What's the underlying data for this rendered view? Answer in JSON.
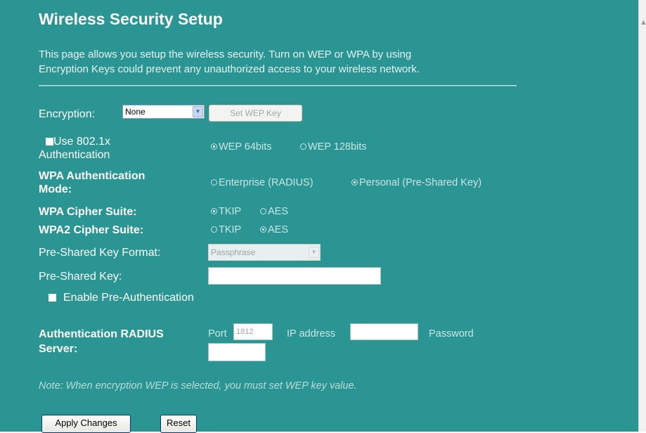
{
  "page": {
    "title": "Wireless Security Setup",
    "description_line1": "This page allows you setup the wireless security. Turn on WEP or WPA by using",
    "description_line2": "Encryption Keys could prevent any unauthorized access to your wireless network."
  },
  "encryption": {
    "label": "Encryption:",
    "selected": "None",
    "set_wep_key_button": "Set WEP Key"
  },
  "use_8021x": {
    "label_line1": "Use 802.1x",
    "label_line2": "Authentication",
    "checked": true,
    "options": [
      {
        "label": "WEP 64bits",
        "selected": true
      },
      {
        "label": "WEP 128bits",
        "selected": false
      }
    ]
  },
  "wpa_auth_mode": {
    "label_line1": "WPA Authentication",
    "label_line2": "Mode:",
    "options": [
      {
        "label": "Enterprise (RADIUS)",
        "selected": false
      },
      {
        "label": "Personal (Pre-Shared Key)",
        "selected": true
      }
    ]
  },
  "wpa_cipher": {
    "label": "WPA Cipher Suite:",
    "options": [
      {
        "label": "TKIP",
        "selected": true
      },
      {
        "label": "AES",
        "selected": false
      }
    ]
  },
  "wpa2_cipher": {
    "label": "WPA2 Cipher Suite:",
    "options": [
      {
        "label": "TKIP",
        "selected": false
      },
      {
        "label": "AES",
        "selected": true
      }
    ]
  },
  "psk_format": {
    "label": "Pre-Shared Key Format:",
    "selected": "Passphrase"
  },
  "psk": {
    "label": "Pre-Shared Key:",
    "value": ""
  },
  "pre_auth": {
    "label": "Enable Pre-Authentication",
    "checked": true
  },
  "radius": {
    "label_line1": "Authentication RADIUS",
    "label_line2": "Server:",
    "port_label": "Port",
    "port_value": "1812",
    "ip_label": "IP address",
    "ip_value": "",
    "password_label": "Password",
    "password_value": ""
  },
  "note": "Note: When encryption WEP is selected, you must set WEP key value.",
  "buttons": {
    "apply": "Apply Changes",
    "reset": "Reset"
  },
  "colors": {
    "background": "#2a9592",
    "text": "#ffffff",
    "muted_text": "#c9e6e4"
  }
}
